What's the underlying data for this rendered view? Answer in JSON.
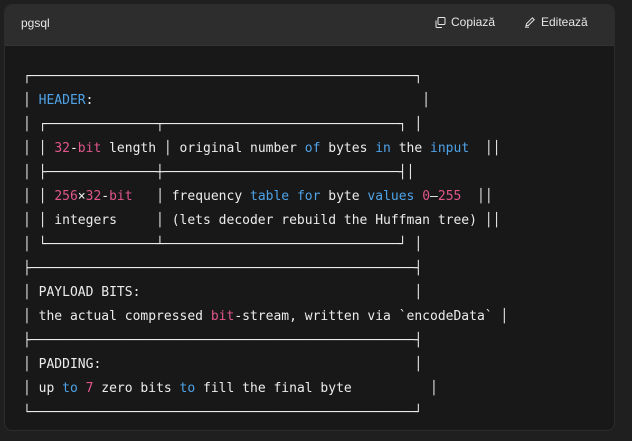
{
  "header": {
    "language": "pgsql",
    "copy_label": "Copiază",
    "edit_label": "Editează",
    "copy_icon": "copy-icon",
    "edit_icon": "edit-pencil-icon"
  },
  "colors": {
    "keyword": "#4ea3e8",
    "number": "#e0568a",
    "text": "#ececec"
  },
  "code_lines": [
    [
      {
        "t": "┌─────────────────────────────────────────────────┐",
        "c": "plain"
      }
    ],
    [
      {
        "t": "│ ",
        "c": "plain"
      },
      {
        "t": "HEADER",
        "c": "kw"
      },
      {
        "t": ":                                          │",
        "c": "plain"
      }
    ],
    [
      {
        "t": "│ ┌──────────────┬──────────────────────────────┐ │",
        "c": "plain"
      }
    ],
    [
      {
        "t": "│ │ ",
        "c": "plain"
      },
      {
        "t": "32",
        "c": "num"
      },
      {
        "t": "-",
        "c": "plain"
      },
      {
        "t": "bit",
        "c": "num"
      },
      {
        "t": " length │ original number ",
        "c": "plain"
      },
      {
        "t": "of",
        "c": "kw"
      },
      {
        "t": " bytes ",
        "c": "plain"
      },
      {
        "t": "in",
        "c": "kw"
      },
      {
        "t": " the ",
        "c": "plain"
      },
      {
        "t": "input",
        "c": "kw"
      },
      {
        "t": "  ││",
        "c": "plain"
      }
    ],
    [
      {
        "t": "│ ├──────────────┼──────────────────────────────┤│",
        "c": "plain"
      }
    ],
    [
      {
        "t": "│ │ ",
        "c": "plain"
      },
      {
        "t": "256",
        "c": "num"
      },
      {
        "t": "×",
        "c": "plain"
      },
      {
        "t": "32",
        "c": "num"
      },
      {
        "t": "-",
        "c": "plain"
      },
      {
        "t": "bit",
        "c": "num"
      },
      {
        "t": "   │ frequency ",
        "c": "plain"
      },
      {
        "t": "table",
        "c": "kw"
      },
      {
        "t": " ",
        "c": "plain"
      },
      {
        "t": "for",
        "c": "kw"
      },
      {
        "t": " byte ",
        "c": "plain"
      },
      {
        "t": "values",
        "c": "kw"
      },
      {
        "t": " ",
        "c": "plain"
      },
      {
        "t": "0",
        "c": "num"
      },
      {
        "t": "–",
        "c": "plain"
      },
      {
        "t": "255",
        "c": "num"
      },
      {
        "t": "  ││",
        "c": "plain"
      }
    ],
    [
      {
        "t": "│ │ integers     │ (lets decoder rebuild the Huffman tree) ││",
        "c": "plain"
      }
    ],
    [
      {
        "t": "│ └──────────────┴──────────────────────────────┘ │",
        "c": "plain"
      }
    ],
    [
      {
        "t": "├─────────────────────────────────────────────────┤",
        "c": "plain"
      }
    ],
    [
      {
        "t": "│ PAYLOAD BITS:                                   │",
        "c": "plain"
      }
    ],
    [
      {
        "t": "│ the actual compressed ",
        "c": "plain"
      },
      {
        "t": "bit",
        "c": "num"
      },
      {
        "t": "-stream, written via `encodeData` │",
        "c": "plain"
      }
    ],
    [
      {
        "t": "├─────────────────────────────────────────────────┤",
        "c": "plain"
      }
    ],
    [
      {
        "t": "│ PADDING:                                        │",
        "c": "plain"
      }
    ],
    [
      {
        "t": "│ up ",
        "c": "plain"
      },
      {
        "t": "to",
        "c": "kw"
      },
      {
        "t": " ",
        "c": "plain"
      },
      {
        "t": "7",
        "c": "num"
      },
      {
        "t": " zero bits ",
        "c": "plain"
      },
      {
        "t": "to",
        "c": "kw"
      },
      {
        "t": " fill the final byte          │",
        "c": "plain"
      }
    ],
    [
      {
        "t": "└─────────────────────────────────────────────────┘",
        "c": "plain"
      }
    ]
  ]
}
